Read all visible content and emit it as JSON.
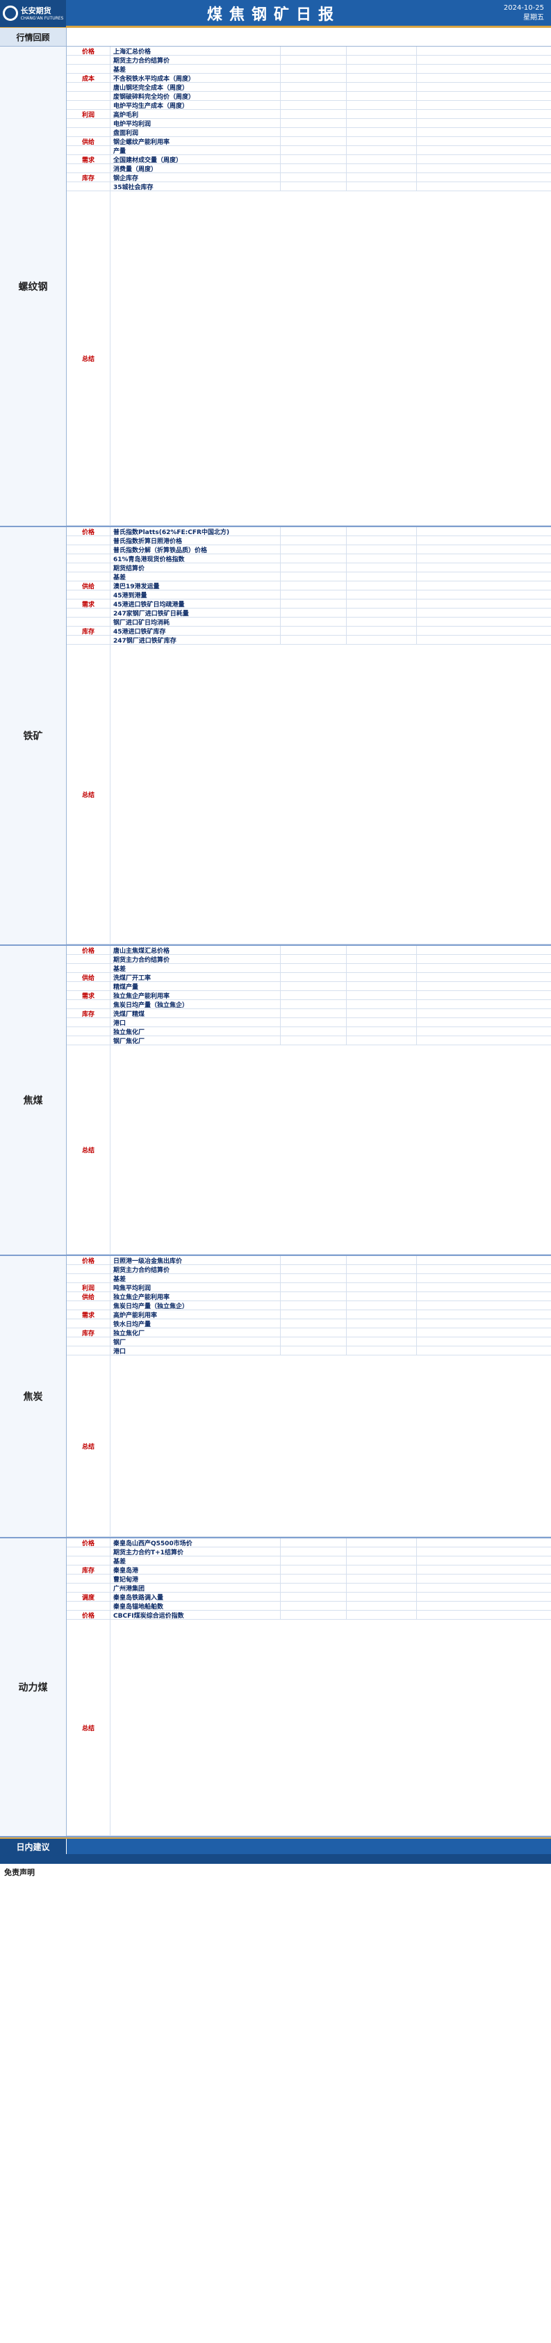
{
  "header": {
    "logo_cn": "长安期货",
    "logo_en": "CHANG'AN FUTURES",
    "title": "煤焦钢矿日报",
    "date": "2024-10-25",
    "weekday": "星期五"
  },
  "review": {
    "label": "行情回顾",
    "text": ""
  },
  "sections": [
    {
      "name": "螺纹钢",
      "label_height": 735,
      "rows": [
        {
          "grp": "价格",
          "item": "上海汇总价格",
          "value": "",
          "chg": "",
          "dir": "up"
        },
        {
          "grp": "",
          "item": "期货主力合约结算价",
          "value": "",
          "chg": "",
          "dir": "up"
        },
        {
          "grp": "",
          "item": "基差",
          "value": "",
          "chg": "",
          "dir": "up"
        },
        {
          "grp": "成本",
          "item": "不含税铁水平均成本（周度）",
          "value": "",
          "chg": "",
          "dir": "up"
        },
        {
          "grp": "",
          "item": "唐山钢坯完全成本（周度）",
          "value": "",
          "chg": "",
          "dir": "up"
        },
        {
          "grp": "",
          "item": "废钢破碎料完全均价（周度）",
          "value": "",
          "chg": "",
          "dir": "up"
        },
        {
          "grp": "",
          "item": "电炉平均生产成本（周度）",
          "value": "",
          "chg": "",
          "dir": "up"
        },
        {
          "grp": "利润",
          "item": "高炉毛利",
          "value": "",
          "chg": "",
          "dir": "up"
        },
        {
          "grp": "",
          "item": "电炉平均利润",
          "value": "",
          "chg": "",
          "dir": "up"
        },
        {
          "grp": "",
          "item": "盘面利润",
          "value": "",
          "chg": "",
          "dir": "up"
        },
        {
          "grp": "供给",
          "item": "钢企螺纹产能利用率",
          "value": "",
          "chg": "",
          "dir": "up"
        },
        {
          "grp": "",
          "item": "产量",
          "value": "",
          "chg": "",
          "dir": "up"
        },
        {
          "grp": "需求",
          "item": "全国建材成交量（周度）",
          "value": "",
          "chg": "",
          "dir": "up"
        },
        {
          "grp": "",
          "item": "消费量（周度）",
          "value": "",
          "chg": "",
          "dir": "down"
        },
        {
          "grp": "库存",
          "item": "钢企库存",
          "value": "",
          "chg": "",
          "dir": "down"
        },
        {
          "grp": "",
          "item": "35城社会库存",
          "value": "",
          "chg": "",
          "dir": "up"
        }
      ],
      "summary_label": "总结",
      "summary": "",
      "summary_height": 480
    },
    {
      "name": "铁矿",
      "label_height": 630,
      "rows": [
        {
          "grp": "价格",
          "item": "普氏指数Platts(62%FE:CFR中国北方)",
          "value": "",
          "chg": "",
          "dir": "down"
        },
        {
          "grp": "",
          "item": "普氏指数折算日照港价格",
          "value": "",
          "chg": "",
          "dir": "down"
        },
        {
          "grp": "",
          "item": "普氏指数分解（折算铁品质）价格",
          "value": "",
          "chg": "",
          "dir": "down"
        },
        {
          "grp": "",
          "item": "61%青岛港现货价格指数",
          "value": "",
          "chg": "",
          "dir": "up"
        },
        {
          "grp": "",
          "item": "期货结算价",
          "value": "",
          "chg": "",
          "dir": "up"
        },
        {
          "grp": "",
          "item": "基差",
          "value": "",
          "chg": "",
          "dir": "up"
        },
        {
          "grp": "供给",
          "item": "澳巴19港发运量",
          "value": "",
          "chg": "",
          "dir": "down"
        },
        {
          "grp": "",
          "item": "45港到港量",
          "value": "",
          "chg": "",
          "dir": "down"
        },
        {
          "grp": "需求",
          "item": "45港进口铁矿日均疏港量",
          "value": "",
          "chg": "",
          "dir": "up"
        },
        {
          "grp": "",
          "item": "247家钢厂进口铁矿日耗量",
          "value": "",
          "chg": "",
          "dir": "up"
        },
        {
          "grp": "",
          "item": "钢厂进口矿日均消耗",
          "value": "",
          "chg": "",
          "dir": "up"
        },
        {
          "grp": "库存",
          "item": "45港进口铁矿库存",
          "value": "",
          "chg": "",
          "dir": "up"
        },
        {
          "grp": "",
          "item": "247钢厂进口铁矿库存",
          "value": "",
          "chg": "",
          "dir": "up"
        }
      ],
      "summary_label": "总结",
      "summary": "",
      "summary_height": 430
    },
    {
      "name": "焦煤",
      "label_height": 660,
      "rows": [
        {
          "grp": "价格",
          "item": "唐山主焦煤汇总价格",
          "value": "",
          "chg": "",
          "dir": "up"
        },
        {
          "grp": "",
          "item": "期货主力合约结算价",
          "value": "",
          "chg": "",
          "dir": "down"
        },
        {
          "grp": "",
          "item": "基差",
          "value": "",
          "chg": "",
          "dir": "down"
        },
        {
          "grp": "供给",
          "item": "洗煤厂开工率",
          "value": "",
          "chg": "",
          "dir": "up"
        },
        {
          "grp": "",
          "item": "精煤产量",
          "value": "",
          "chg": "",
          "dir": "up"
        },
        {
          "grp": "需求",
          "item": "独立焦企产能利用率",
          "value": "",
          "chg": "",
          "dir": "up"
        },
        {
          "grp": "",
          "item": "焦炭日均产量（独立焦企）",
          "value": "",
          "chg": "",
          "dir": "up"
        },
        {
          "grp": "库存",
          "item": "洗煤厂精煤",
          "value": "",
          "chg": "",
          "dir": "down"
        },
        {
          "grp": "",
          "item": "港口",
          "value": "",
          "chg": "",
          "dir": "down"
        },
        {
          "grp": "",
          "item": "独立焦化厂",
          "value": "",
          "chg": "",
          "dir": "up"
        },
        {
          "grp": "",
          "item": "钢厂焦化厂",
          "value": "",
          "chg": "",
          "dir": "up"
        }
      ],
      "summary_label": "总结",
      "summary": "",
      "summary_height": 300
    },
    {
      "name": "焦炭",
      "label_height": 585,
      "rows": [
        {
          "grp": "价格",
          "item": "日照港一级冶金焦出库价",
          "value": "",
          "chg": "",
          "dir": "down"
        },
        {
          "grp": "",
          "item": "期货主力合约结算价",
          "value": "",
          "chg": "",
          "dir": "down"
        },
        {
          "grp": "",
          "item": "基差",
          "value": "",
          "chg": "",
          "dir": "up"
        },
        {
          "grp": "利润",
          "item": "吨焦平均利润",
          "value": "",
          "chg": "",
          "dir": "up"
        },
        {
          "grp": "供给",
          "item": "独立焦企产能利用率",
          "value": "",
          "chg": "",
          "dir": "up"
        },
        {
          "grp": "",
          "item": "焦炭日均产量（独立焦企）",
          "value": "",
          "chg": "",
          "dir": "up"
        },
        {
          "grp": "需求",
          "item": "高炉产能利用率",
          "value": "",
          "chg": "",
          "dir": "up"
        },
        {
          "grp": "",
          "item": "铁水日均产量",
          "value": "",
          "chg": "",
          "dir": "up"
        },
        {
          "grp": "库存",
          "item": "独立焦化厂",
          "value": "",
          "chg": "",
          "dir": "down"
        },
        {
          "grp": "",
          "item": "钢厂",
          "value": "",
          "chg": "",
          "dir": "down"
        },
        {
          "grp": "",
          "item": "港口",
          "value": "",
          "chg": "",
          "dir": "down"
        }
      ],
      "summary_label": "总结",
      "summary": "",
      "summary_height": 260
    },
    {
      "name": "动力煤",
      "label_height": 575,
      "rows": [
        {
          "grp": "价格",
          "item": "秦皇岛山西产Q5500市场价",
          "value": "",
          "chg": "",
          "dir": "up"
        },
        {
          "grp": "",
          "item": "期货主力合约T+1结算价",
          "value": "",
          "chg": "",
          "dir": "up"
        },
        {
          "grp": "",
          "item": "基差",
          "value": "",
          "chg": "",
          "dir": "up"
        },
        {
          "grp": "库存",
          "item": "秦皇岛港",
          "value": "",
          "chg": "",
          "dir": "down"
        },
        {
          "grp": "",
          "item": "曹妃甸港",
          "value": "",
          "chg": "",
          "dir": "down"
        },
        {
          "grp": "",
          "item": "广州港集团",
          "value": "",
          "chg": "",
          "dir": "down"
        },
        {
          "grp": "调度",
          "item": "秦皇岛铁路调入量",
          "value": "",
          "chg": "",
          "dir": "up"
        },
        {
          "grp": "",
          "item": "秦皇岛锚地船舶数",
          "value": "",
          "chg": "",
          "dir": "up"
        },
        {
          "grp": "价格",
          "item": "CBCFI煤炭综合运价指数",
          "value": "",
          "chg": "",
          "dir": "up"
        }
      ],
      "summary_label": "总结",
      "summary": "",
      "summary_height": 310
    }
  ],
  "footer": {
    "label": "日内建议",
    "text": "",
    "contact": ""
  },
  "disclaimer": {
    "title": "免责声明",
    "text": ""
  }
}
